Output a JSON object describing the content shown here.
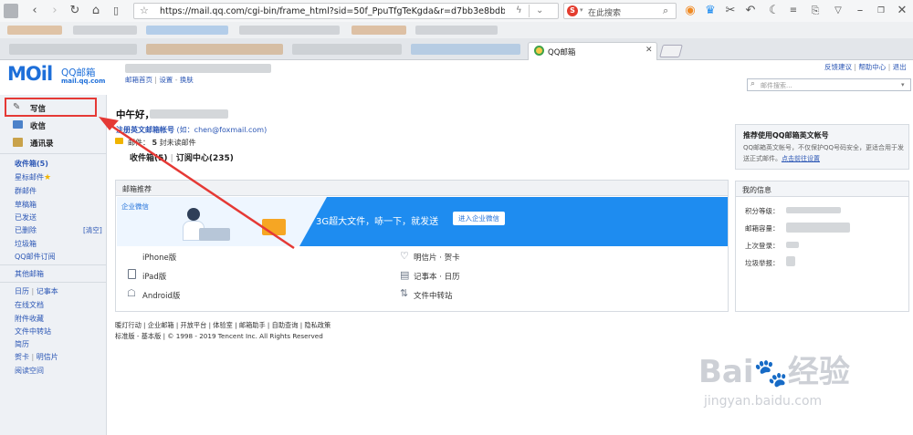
{
  "browser": {
    "url": "https://mail.qq.com/cgi-bin/frame_html?sid=50f_PpuTfgTeKgda&r=d7bb3e8bdb542e6bd",
    "search_placeholder": "在此搜索",
    "tab_title": "QQ邮箱"
  },
  "header": {
    "logo_text": "MOil",
    "logo_cn": "QQ邮箱",
    "logo_domain": "mail.qq.com",
    "nav": [
      "邮箱首页",
      "设置",
      "换肤"
    ],
    "top_links": [
      "反馈建议",
      "帮助中心",
      "退出"
    ],
    "mail_search_placeholder": "邮件搜索..."
  },
  "sidebar": {
    "compose": "写信",
    "receive": "收信",
    "contacts": "通讯录",
    "folders": [
      "收件箱(5)",
      "星标邮件",
      "群邮件",
      "草稿箱",
      "已发送",
      "已删除",
      "垃圾箱",
      "QQ邮件订阅"
    ],
    "clear_label": "[清空]",
    "other_mailbox": "其他邮箱",
    "tools_row1": [
      "日历",
      "记事本"
    ],
    "tools": [
      "在线文档",
      "附件收藏",
      "文件中转站",
      "简历"
    ],
    "tools_row2": [
      "贺卡",
      "明信片"
    ],
    "reading": "阅读空间"
  },
  "welcome": {
    "greeting": "中午好，",
    "english_tip": "注册英文邮箱帐号",
    "english_example": "(如：chen@foxmail.com)",
    "unread_prefix": "邮件：",
    "unread_count": "5",
    "unread_suffix": "封未读邮件",
    "inbox_link": "收件箱(5)",
    "subscribe_link": "订阅中心(235)"
  },
  "promo": {
    "title": "邮箱推荐",
    "banner_brand": "企业微信",
    "banner_text": "3G超大文件，哧一下，就发送",
    "banner_button": "进入企业微信",
    "apps": [
      {
        "icon": "apple-icon",
        "label": "iPhone版"
      },
      {
        "icon": "ipad-icon",
        "label": "iPad版"
      },
      {
        "icon": "android-icon",
        "label": "Android版"
      },
      {
        "icon": "heart-icon",
        "label": "明信片 · 贺卡"
      },
      {
        "icon": "notebook-icon",
        "label": "记事本 · 日历"
      },
      {
        "icon": "file-transfer-icon",
        "label": "文件中转站"
      }
    ]
  },
  "english_account": {
    "title": "推荐使用QQ邮箱英文帐号",
    "desc": "QQ邮箱英文帐号，不仅保护QQ号码安全，更适合用于发送正式邮件。",
    "link": "点击前往设置"
  },
  "my_info": {
    "title": "我的信息",
    "rows": [
      "积分等级：",
      "邮箱容量：",
      "上次登录：",
      "垃圾举报："
    ]
  },
  "footer": {
    "links": [
      "暖灯行动",
      "企业邮箱",
      "开放平台",
      "体验室",
      "邮箱助手",
      "自助查询",
      "隐私政策"
    ],
    "versions": "标准版 - 基本版",
    "copyright": "© 1998 - 2019 Tencent Inc. All Rights Reserved"
  },
  "watermark": {
    "brand": "Bai",
    "brand2": "经验",
    "domain": "jingyan.baidu.com"
  },
  "colors": {
    "accent": "#1e8cf0",
    "link": "#2c57b5",
    "annotation": "#e53935"
  }
}
